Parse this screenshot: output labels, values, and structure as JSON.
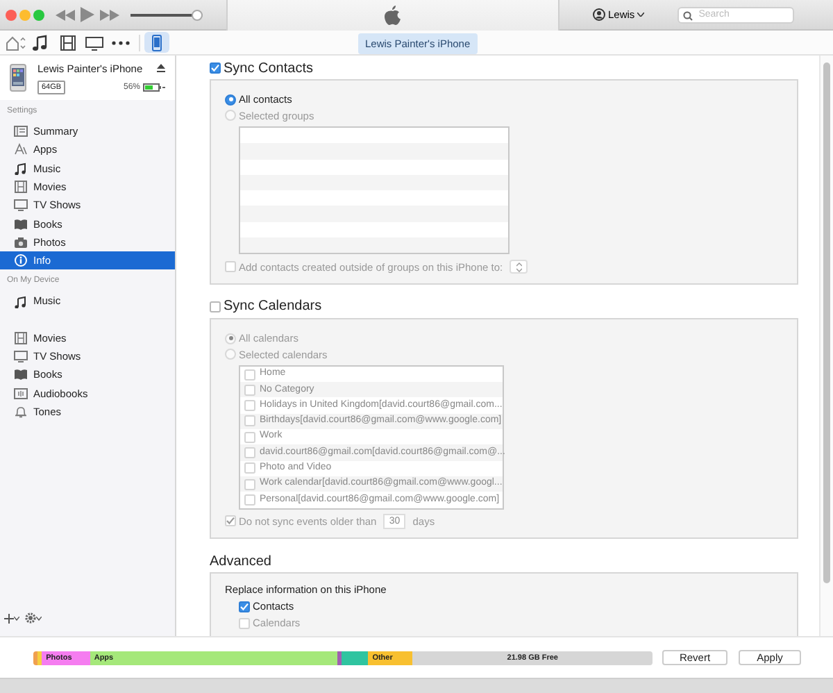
{
  "player": {
    "volume": {
      "level": 0.92
    }
  },
  "account": {
    "name": "Lewis"
  },
  "search": {
    "placeholder": "Search"
  },
  "media_bar": {
    "items": [
      {
        "kind": "home",
        "selected": false
      },
      {
        "kind": "music",
        "selected": false
      },
      {
        "kind": "movies",
        "selected": false
      },
      {
        "kind": "tv",
        "selected": false
      },
      {
        "kind": "more",
        "selected": false
      },
      {
        "kind": "device",
        "selected": true
      }
    ],
    "device_tab": "Lewis Painter's iPhone"
  },
  "sidebar": {
    "device": {
      "name": "Lewis Painter's iPhone",
      "capacity": "64GB",
      "battery": "56%"
    },
    "sections": [
      {
        "title": "Settings",
        "items": [
          {
            "label": "Summary",
            "kind": "summary",
            "selected": false
          },
          {
            "label": "Apps",
            "kind": "apps",
            "selected": false
          },
          {
            "label": "Music",
            "kind": "music",
            "selected": false
          },
          {
            "label": "Movies",
            "kind": "movies",
            "selected": false
          },
          {
            "label": "TV Shows",
            "kind": "tv",
            "selected": false
          },
          {
            "label": "Books",
            "kind": "books",
            "selected": false
          },
          {
            "label": "Photos",
            "kind": "photos",
            "selected": false
          },
          {
            "label": "Info",
            "kind": "info",
            "selected": true
          }
        ]
      },
      {
        "title": "On My Device",
        "items": [
          {
            "label": "Music",
            "kind": "music",
            "selected": false
          },
          {
            "label": "Movies",
            "kind": "movies",
            "selected": false,
            "gap_before": true
          },
          {
            "label": "TV Shows",
            "kind": "tv",
            "selected": false
          },
          {
            "label": "Books",
            "kind": "books",
            "selected": false
          },
          {
            "label": "Audiobooks",
            "kind": "audiobooks",
            "selected": false
          },
          {
            "label": "Tones",
            "kind": "tones",
            "selected": false
          }
        ]
      }
    ]
  },
  "contacts": {
    "title": "Sync Contacts",
    "checked": true,
    "options": [
      {
        "label": "All contacts",
        "selected": true,
        "disabled": false
      },
      {
        "label": "Selected groups",
        "selected": false,
        "disabled": true
      }
    ],
    "add_outside": {
      "label": "Add contacts created outside of groups on this iPhone to:",
      "checked": false,
      "disabled": true
    }
  },
  "calendars": {
    "title": "Sync Calendars",
    "checked": false,
    "options": [
      {
        "label": "All calendars",
        "selected": true,
        "disabled": true
      },
      {
        "label": "Selected calendars",
        "selected": false,
        "disabled": true
      }
    ],
    "list": [
      {
        "label": "Home",
        "checked": false
      },
      {
        "label": "No Category",
        "checked": false
      },
      {
        "label": "Holidays in United Kingdom[david.court86@gmail.com...",
        "checked": false
      },
      {
        "label": "Birthdays[david.court86@gmail.com@www.google.com]",
        "checked": false
      },
      {
        "label": "Work",
        "checked": false
      },
      {
        "label": "david.court86@gmail.com[david.court86@gmail.com@...",
        "checked": false
      },
      {
        "label": "Photo and Video",
        "checked": false
      },
      {
        "label": "Work calendar[david.court86@gmail.com@www.googl...",
        "checked": false
      },
      {
        "label": "Personal[david.court86@gmail.com@www.google.com]",
        "checked": false
      }
    ],
    "limit": {
      "label": "Do not sync events older than",
      "checked": true,
      "disabled": true,
      "value": "30",
      "unit": "days"
    }
  },
  "advanced": {
    "title": "Advanced",
    "replace_label": "Replace information on this iPhone",
    "items": [
      {
        "label": "Contacts",
        "checked": true,
        "disabled": false
      },
      {
        "label": "Calendars",
        "checked": false,
        "disabled": true
      }
    ]
  },
  "storage": {
    "segments": [
      {
        "color": "#f0a050"
      },
      {
        "color": "#f5d040"
      },
      {
        "label": "Photos",
        "color": "#f57df0"
      },
      {
        "label": "Apps",
        "color": "#a5e87a"
      },
      {
        "color": "#a060b0"
      },
      {
        "color": "#2fc4a0"
      },
      {
        "label": "Other",
        "color": "#f8c030"
      },
      {
        "label": "21.98 GB Free",
        "color": "#d6d6d6"
      }
    ]
  },
  "buttons": [
    "Revert",
    "Apply"
  ]
}
